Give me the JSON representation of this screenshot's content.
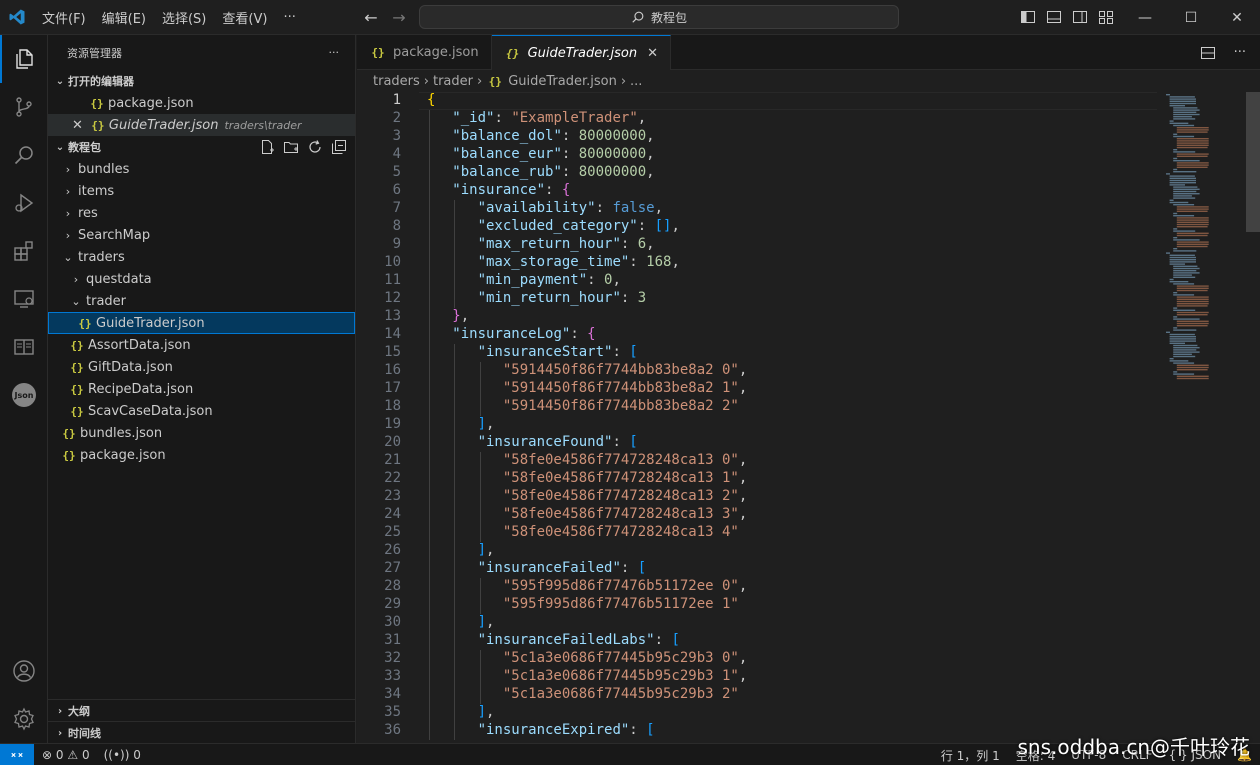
{
  "titlebar": {
    "menu": [
      "文件(F)",
      "编辑(E)",
      "选择(S)",
      "查看(V)",
      "···"
    ],
    "search_text": "教程包"
  },
  "sidebar": {
    "title": "资源管理器",
    "more": "···",
    "open_editors_label": "打开的编辑器",
    "open_editors": [
      {
        "name": "package.json",
        "hint": ""
      },
      {
        "name": "GuideTrader.json",
        "hint": "traders\\trader"
      }
    ],
    "workspace_label": "教程包",
    "tree": [
      {
        "name": "bundles",
        "type": "folder",
        "depth": 1,
        "open": false
      },
      {
        "name": "items",
        "type": "folder",
        "depth": 1,
        "open": false
      },
      {
        "name": "res",
        "type": "folder",
        "depth": 1,
        "open": false
      },
      {
        "name": "SearchMap",
        "type": "folder",
        "depth": 1,
        "open": false
      },
      {
        "name": "traders",
        "type": "folder",
        "depth": 1,
        "open": true
      },
      {
        "name": "questdata",
        "type": "folder",
        "depth": 2,
        "open": false
      },
      {
        "name": "trader",
        "type": "folder",
        "depth": 2,
        "open": true
      },
      {
        "name": "GuideTrader.json",
        "type": "json",
        "depth": 3,
        "selected": true
      },
      {
        "name": "AssortData.json",
        "type": "json",
        "depth": 2
      },
      {
        "name": "GiftData.json",
        "type": "json",
        "depth": 2
      },
      {
        "name": "RecipeData.json",
        "type": "json",
        "depth": 2
      },
      {
        "name": "ScavCaseData.json",
        "type": "json",
        "depth": 2
      },
      {
        "name": "bundles.json",
        "type": "json",
        "depth": 1
      },
      {
        "name": "package.json",
        "type": "json",
        "depth": 1
      }
    ],
    "outline_label": "大纲",
    "timeline_label": "时间线"
  },
  "tabs": [
    {
      "name": "package.json",
      "active": false
    },
    {
      "name": "GuideTrader.json",
      "active": true
    }
  ],
  "breadcrumb": [
    "traders",
    "trader",
    "GuideTrader.json",
    "..."
  ],
  "code_lines": [
    "{",
    "   \"_id\": \"ExampleTrader\",",
    "   \"balance_dol\": 80000000,",
    "   \"balance_eur\": 80000000,",
    "   \"balance_rub\": 80000000,",
    "   \"insurance\": {",
    "      \"availability\": false,",
    "      \"excluded_category\": [],",
    "      \"max_return_hour\": 6,",
    "      \"max_storage_time\": 168,",
    "      \"min_payment\": 0,",
    "      \"min_return_hour\": 3",
    "   },",
    "   \"insuranceLog\": {",
    "      \"insuranceStart\": [",
    "         \"5914450f86f7744bb83be8a2 0\",",
    "         \"5914450f86f7744bb83be8a2 1\",",
    "         \"5914450f86f7744bb83be8a2 2\"",
    "      ],",
    "      \"insuranceFound\": [",
    "         \"58fe0e4586f774728248ca13 0\",",
    "         \"58fe0e4586f774728248ca13 1\",",
    "         \"58fe0e4586f774728248ca13 2\",",
    "         \"58fe0e4586f774728248ca13 3\",",
    "         \"58fe0e4586f774728248ca13 4\"",
    "      ],",
    "      \"insuranceFailed\": [",
    "         \"595f995d86f77476b51172ee 0\",",
    "         \"595f995d86f77476b51172ee 1\"",
    "      ],",
    "      \"insuranceFailedLabs\": [",
    "         \"5c1a3e0686f77445b95c29b3 0\",",
    "         \"5c1a3e0686f77445b95c29b3 1\",",
    "         \"5c1a3e0686f77445b95c29b3 2\"",
    "      ],",
    "      \"insuranceExpired\": ["
  ],
  "statusbar": {
    "errors": "0",
    "warnings": "0",
    "ports": "0",
    "position": "行 1，列 1",
    "spaces": "空格: 4",
    "encoding": "UTF-8",
    "eol": "CRLF",
    "language": "{ } JSON"
  },
  "watermark": "sns.oddba.cn@千叶玲花",
  "icons": [
    "explorer-icon",
    "source-control-icon",
    "search-icon",
    "run-debug-icon",
    "extensions-icon",
    "remote-explorer-icon",
    "book-icon",
    "json-icon",
    "account-icon",
    "settings-icon"
  ],
  "colors": {
    "accent": "#0078d4",
    "json_icon": "#cbcb41",
    "key": "#9cdcfe",
    "string": "#ce9178",
    "number": "#b5cea8",
    "keyword": "#569cd6"
  }
}
